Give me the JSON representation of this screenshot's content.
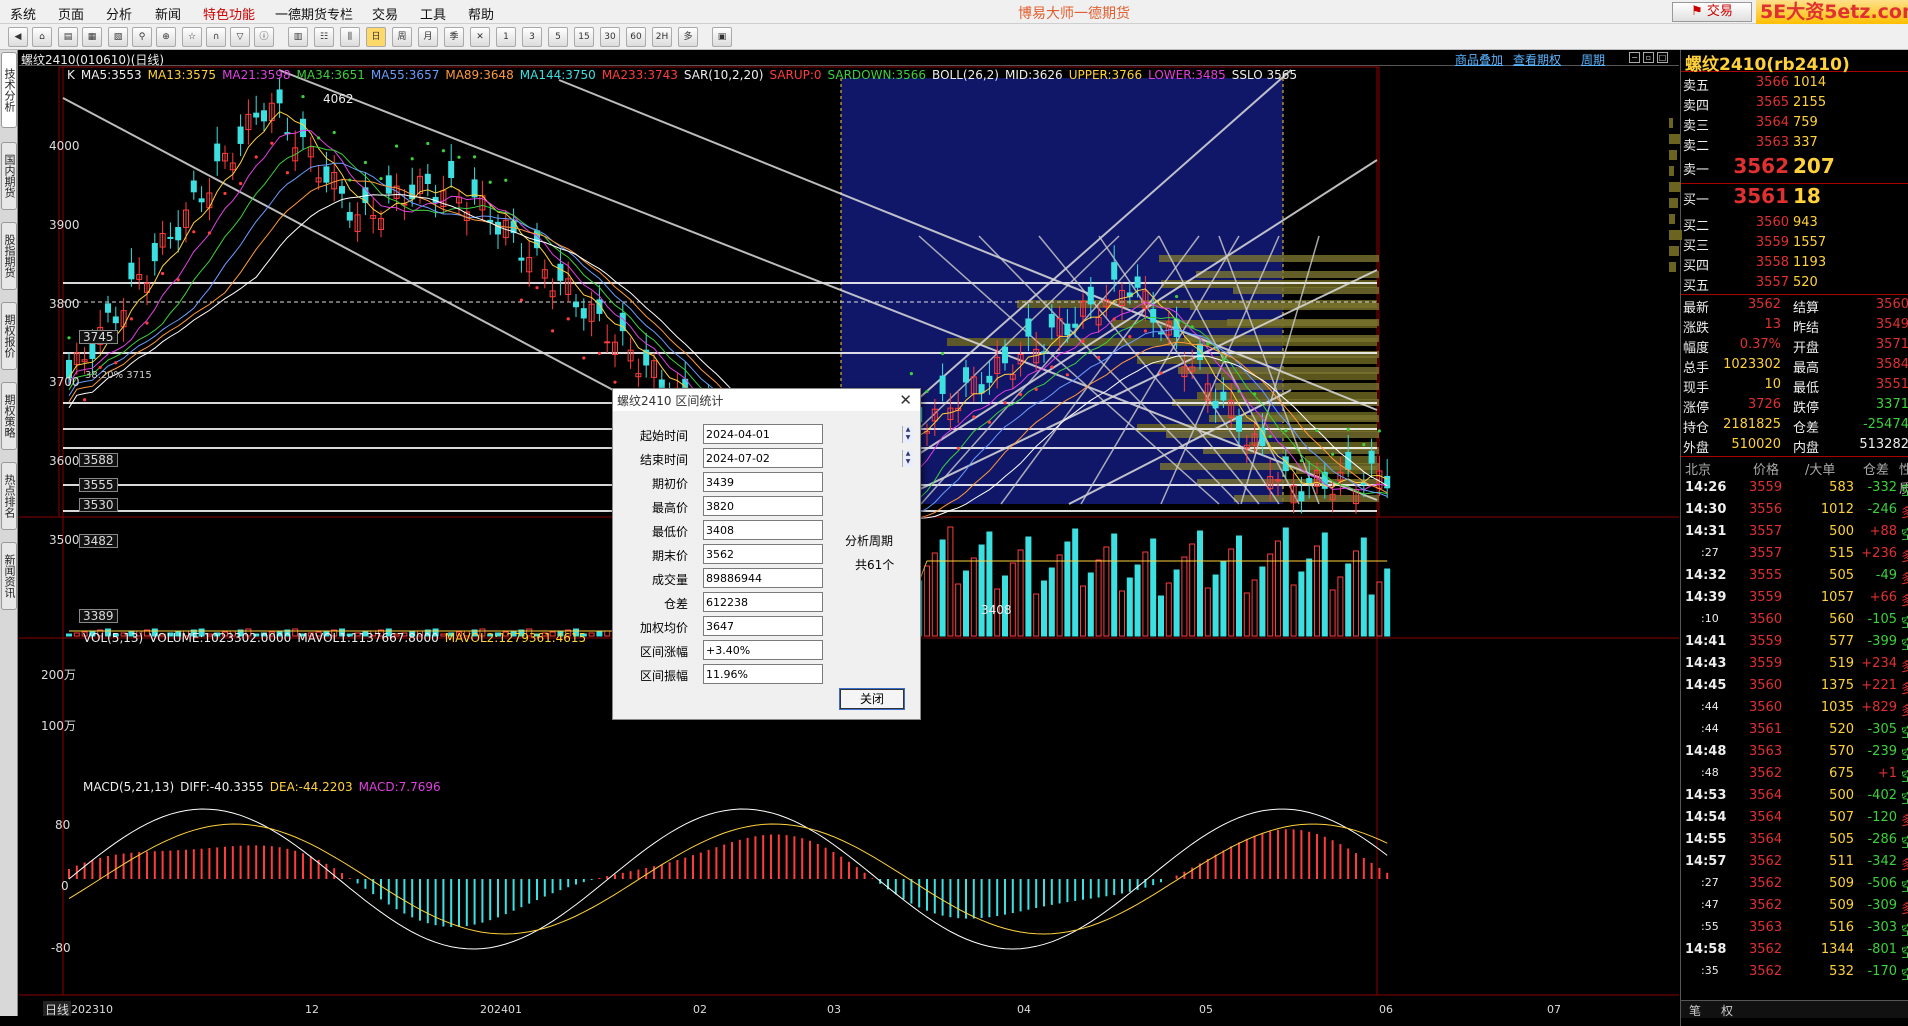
{
  "menubar": {
    "items": [
      "系统",
      "页面",
      "分析",
      "新闻",
      "特色功能",
      "一德期货专栏",
      "交易",
      "工具",
      "帮助"
    ],
    "title": "博易大师一德期货",
    "trade_btn": "交易",
    "watermark": "5E大资5etz.com"
  },
  "left_tabs": [
    "技术分析",
    "国内期货",
    "股指期货",
    "期权报价",
    "期权策略",
    "热点排名",
    "新闻资讯"
  ],
  "header": {
    "contract": "螺纹2410(010610)(日线)",
    "links": [
      "商品叠加",
      "查看期权",
      "周期"
    ]
  },
  "indicators": {
    "ma": [
      {
        "t": "K",
        "c": "#eeeeee"
      },
      {
        "t": "MA5:3553",
        "c": "#eeeeee"
      },
      {
        "t": "MA13:3575",
        "c": "#ffd23c"
      },
      {
        "t": "MA21:3598",
        "c": "#e040e0"
      },
      {
        "t": "MA34:3651",
        "c": "#3cd03c"
      },
      {
        "t": "MA55:3657",
        "c": "#6a9cff"
      },
      {
        "t": "MA89:3648",
        "c": "#ff9a3c"
      },
      {
        "t": "MA144:3750",
        "c": "#3ce0e0"
      },
      {
        "t": "MA233:3743",
        "c": "#ff3c3c"
      },
      {
        "t": "SAR(10,2,20)",
        "c": "#eeeeee"
      },
      {
        "t": "SARUP:0",
        "c": "#ff3c3c"
      },
      {
        "t": "SARDOWN:3566",
        "c": "#3cd03c"
      },
      {
        "t": "BOLL(26,2)",
        "c": "#eeeeee"
      },
      {
        "t": "MID:3626",
        "c": "#eeeeee"
      },
      {
        "t": "UPPER:3766",
        "c": "#ffd23c"
      },
      {
        "t": "LOWER:3485",
        "c": "#e040e0"
      },
      {
        "t": "SSLO 3565",
        "c": "#eeeeee"
      }
    ],
    "vol": [
      {
        "t": "VOL(5,13)",
        "c": "#eeeeee"
      },
      {
        "t": "VOLUME:1023302.0000",
        "c": "#eeeeee"
      },
      {
        "t": "MAVOL1:1137667.8000",
        "c": "#eeeeee"
      },
      {
        "t": "MAVOL2:1279361.4615",
        "c": "#ffd23c"
      }
    ],
    "macd": [
      {
        "t": "MACD(5,21,13)",
        "c": "#eeeeee"
      },
      {
        "t": "DIFF:-40.3355",
        "c": "#eeeeee"
      },
      {
        "t": "DEA:-44.2203",
        "c": "#ffd23c"
      },
      {
        "t": "MACD:7.7696",
        "c": "#e040e0"
      }
    ]
  },
  "price_axis": [
    "4000",
    "3900",
    "3800",
    "3700",
    "3600",
    "3500"
  ],
  "vol_axis": [
    "200万",
    "100万"
  ],
  "macd_axis": [
    "80",
    "0",
    "-80"
  ],
  "date_axis": [
    "日线",
    "202310",
    "12",
    "202401",
    "02",
    "03",
    "04",
    "05",
    "06",
    "07"
  ],
  "annotations": {
    "high": "4062",
    "low": "3408",
    "fib": "38.20%  3715"
  },
  "level_boxes": [
    "3745",
    "3588",
    "3555",
    "3530",
    "3482",
    "3389"
  ],
  "dialog": {
    "title": "螺纹2410 区间统计",
    "rows": [
      {
        "label": "起始时间",
        "value": "2024-04-01"
      },
      {
        "label": "结束时间",
        "value": "2024-07-02"
      },
      {
        "label": "期初价",
        "value": "3439"
      },
      {
        "label": "最高价",
        "value": "3820"
      },
      {
        "label": "最低价",
        "value": "3408"
      },
      {
        "label": "期末价",
        "value": "3562"
      },
      {
        "label": "成交量",
        "value": "89886944"
      },
      {
        "label": "仓差",
        "value": "612238"
      },
      {
        "label": "加权均价",
        "value": "3647"
      },
      {
        "label": "区间涨幅",
        "value": "+3.40%"
      },
      {
        "label": "区间振幅",
        "value": "11.96%"
      }
    ],
    "side1": "分析周期",
    "side2": "共61个",
    "close_btn": "关闭"
  },
  "quote": {
    "title": "螺纹2410(rb2410)",
    "asks": [
      {
        "l": "卖五",
        "p": "3566",
        "v": "1014"
      },
      {
        "l": "卖四",
        "p": "3565",
        "v": "2155"
      },
      {
        "l": "卖三",
        "p": "3564",
        "v": "759"
      },
      {
        "l": "卖二",
        "p": "3563",
        "v": "337"
      },
      {
        "l": "卖一",
        "p": "3562",
        "v": "207"
      }
    ],
    "bids": [
      {
        "l": "买一",
        "p": "3561",
        "v": "18"
      },
      {
        "l": "买二",
        "p": "3560",
        "v": "943"
      },
      {
        "l": "买三",
        "p": "3559",
        "v": "1557"
      },
      {
        "l": "买四",
        "p": "3558",
        "v": "1193"
      },
      {
        "l": "买五",
        "p": "3557",
        "v": "520"
      }
    ],
    "stats": [
      {
        "l": "最新",
        "v": "3562",
        "l2": "结算",
        "v2": "3560"
      },
      {
        "l": "涨跌",
        "v": "13",
        "l2": "昨结",
        "v2": "3549"
      },
      {
        "l": "幅度",
        "v": "0.37%",
        "l2": "开盘",
        "v2": "3571"
      },
      {
        "l": "总手",
        "v": "1023302",
        "l2": "最高",
        "v2": "3584"
      },
      {
        "l": "现手",
        "v": "10",
        "l2": "最低",
        "v2": "3551"
      },
      {
        "l": "涨停",
        "v": "3726",
        "l2": "跌停",
        "v2": "3371"
      },
      {
        "l": "持仓",
        "v": "2181825",
        "l2": "仓差",
        "v2": "-25474"
      },
      {
        "l": "外盘",
        "v": "510020",
        "l2": "内盘",
        "v2": "513282"
      }
    ],
    "tick_header": [
      "北京",
      "价格",
      "/大单",
      "仓差",
      "性质"
    ],
    "ticks": [
      [
        "14:26",
        "3559",
        "583",
        "-332",
        "空"
      ],
      [
        "14:30",
        "3556",
        "1012",
        "-246",
        "多"
      ],
      [
        "14:31",
        "3557",
        "500",
        "+88",
        "空"
      ],
      [
        ":27",
        "3557",
        "515",
        "+236",
        "多"
      ],
      [
        "14:32",
        "3555",
        "505",
        "-49",
        "多"
      ],
      [
        "14:39",
        "3559",
        "1057",
        "+66",
        "多"
      ],
      [
        ":10",
        "3560",
        "560",
        "-105",
        "空"
      ],
      [
        "14:41",
        "3559",
        "577",
        "-399",
        "空"
      ],
      [
        "14:43",
        "3559",
        "519",
        "+234",
        "多"
      ],
      [
        "14:45",
        "3560",
        "1375",
        "+221",
        "多"
      ],
      [
        ":44",
        "3560",
        "1035",
        "+829",
        "多"
      ],
      [
        ":44",
        "3561",
        "520",
        "-305",
        "空"
      ],
      [
        "14:48",
        "3563",
        "570",
        "-239",
        "空"
      ],
      [
        ":48",
        "3562",
        "675",
        "+1",
        "空"
      ],
      [
        "14:53",
        "3564",
        "500",
        "-402",
        "空"
      ],
      [
        "14:54",
        "3564",
        "507",
        "-120",
        "多"
      ],
      [
        "14:55",
        "3564",
        "505",
        "-286",
        "空"
      ],
      [
        "14:57",
        "3562",
        "511",
        "-342",
        "多"
      ],
      [
        ":27",
        "3562",
        "509",
        "-506",
        "空"
      ],
      [
        ":47",
        "3562",
        "509",
        "-309",
        "多"
      ],
      [
        ":55",
        "3563",
        "516",
        "-303",
        "空"
      ],
      [
        "14:58",
        "3562",
        "1344",
        "-801",
        "空"
      ],
      [
        ":35",
        "3562",
        "532",
        "-170",
        "空"
      ]
    ],
    "bottom_tabs": [
      "笔",
      "权"
    ]
  }
}
